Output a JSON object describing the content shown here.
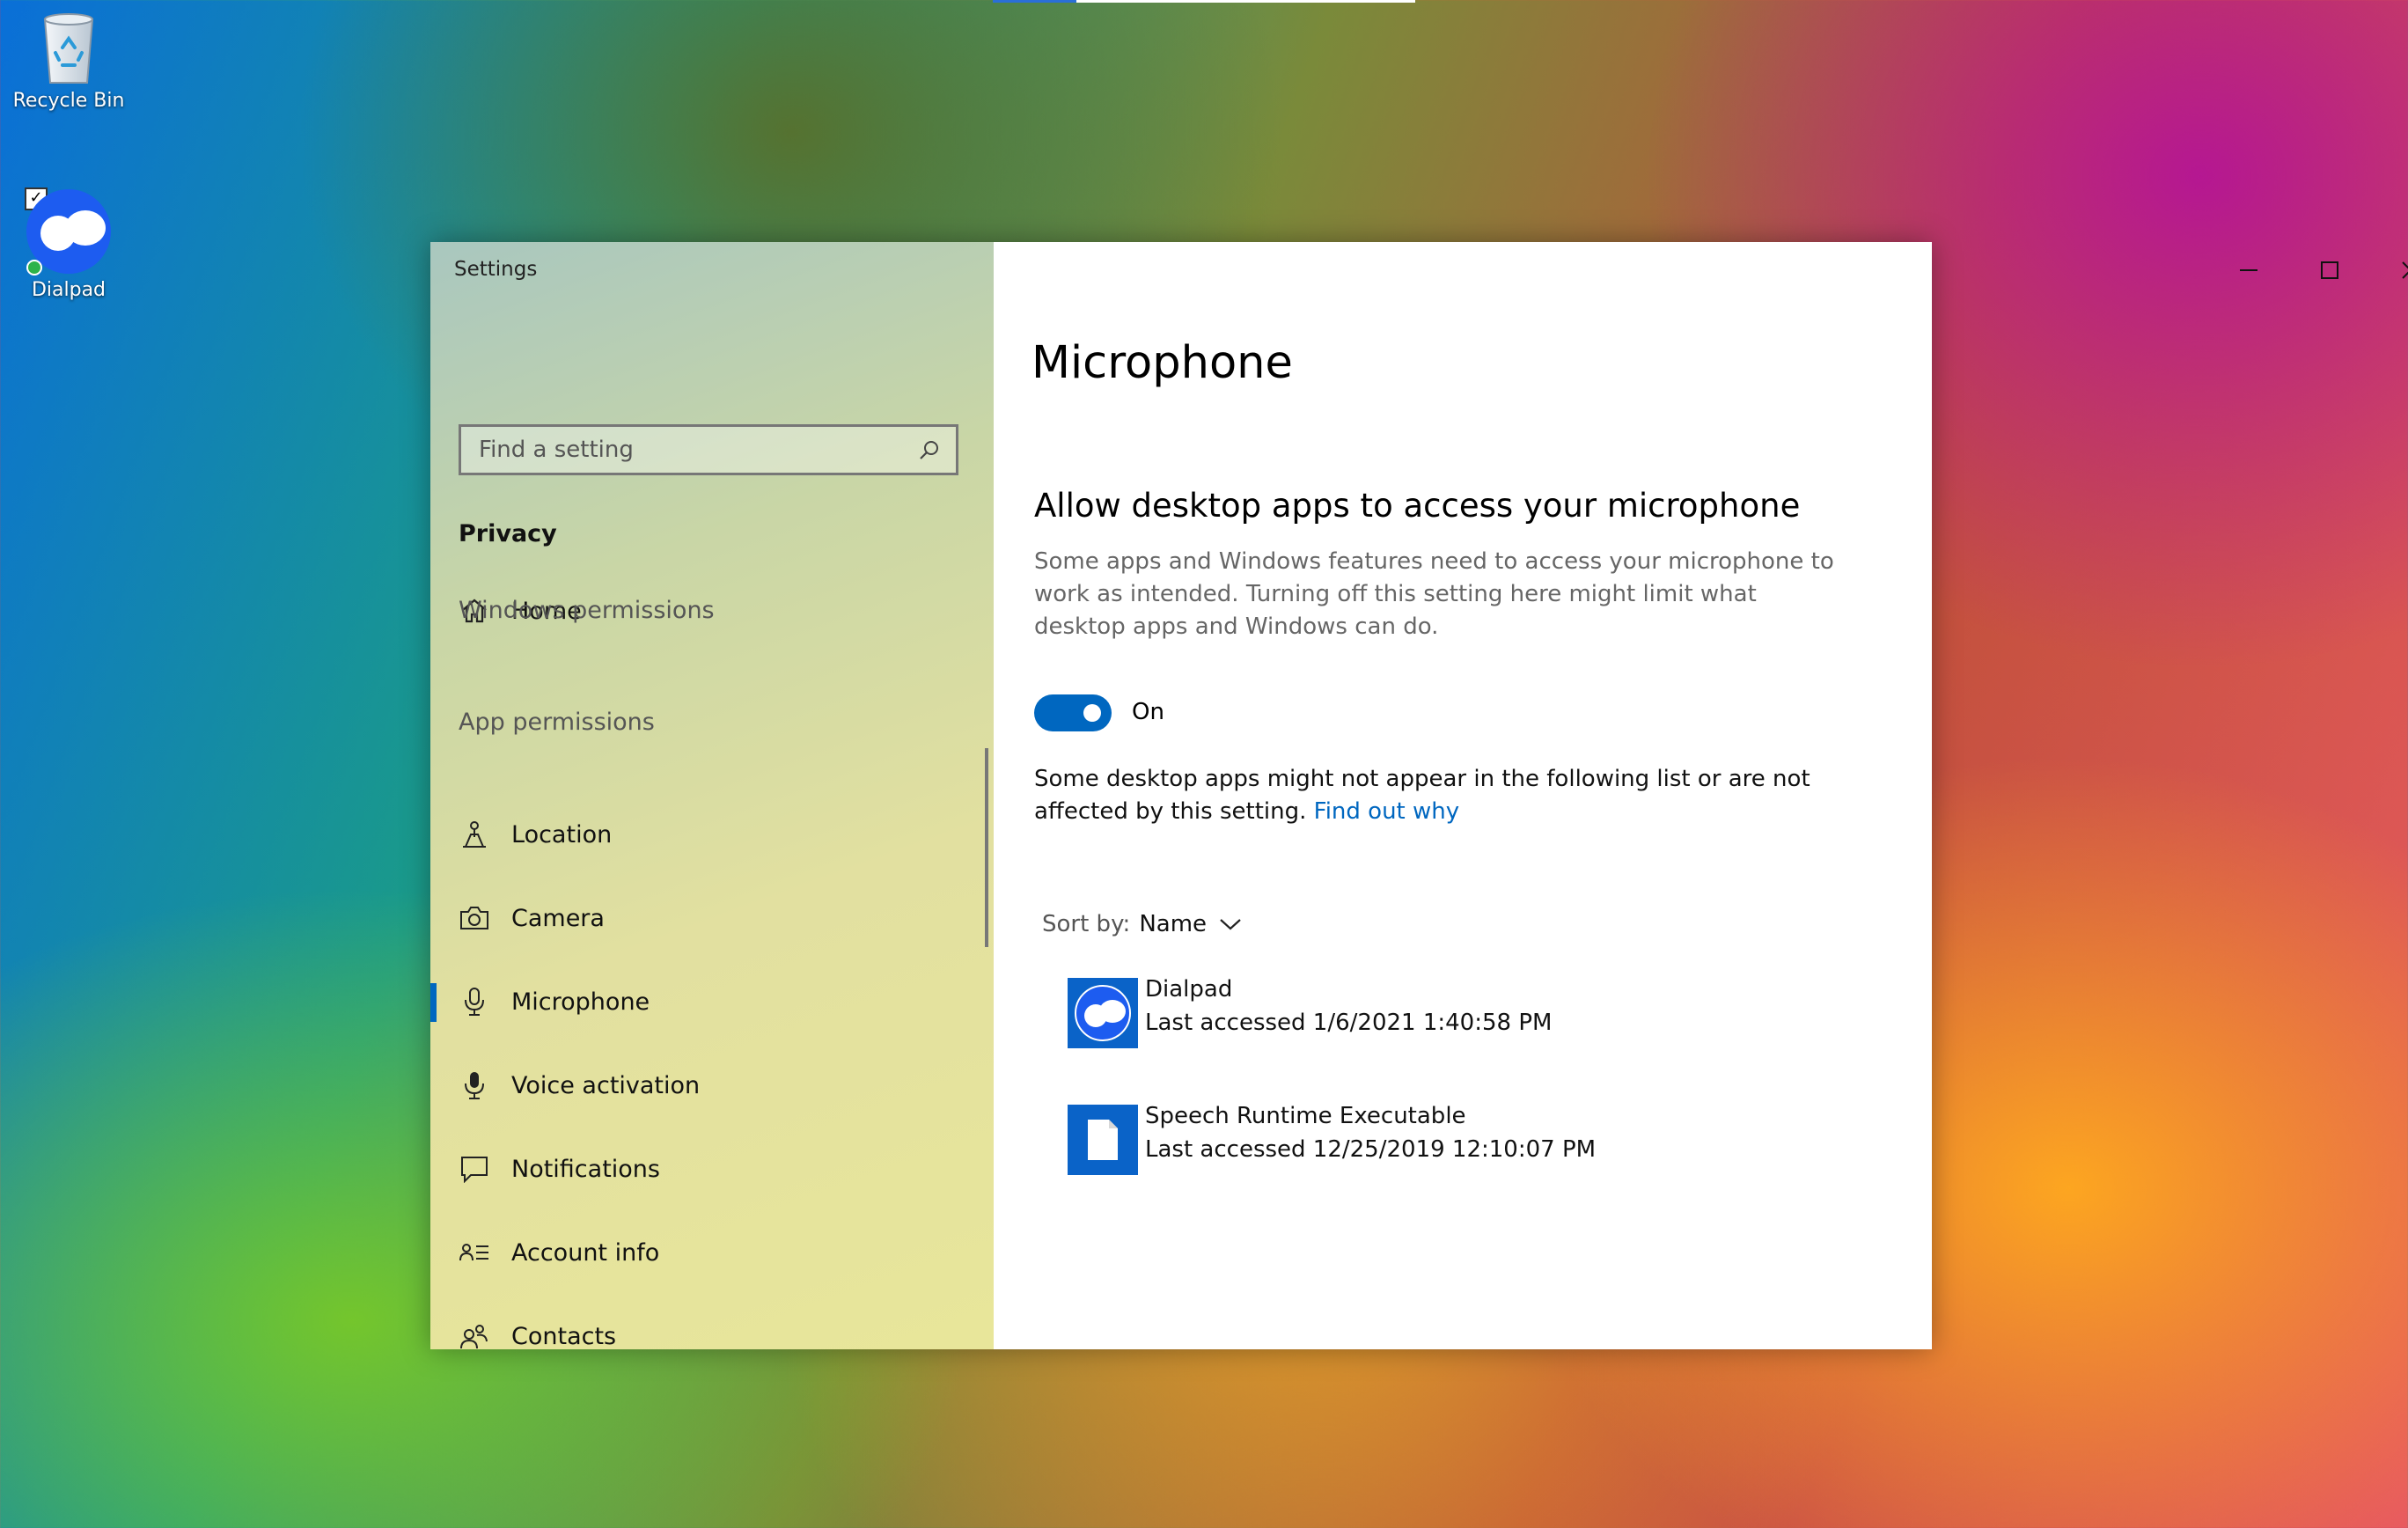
{
  "desktop": {
    "icons": [
      {
        "label": "Recycle Bin"
      },
      {
        "label": "Dialpad"
      }
    ]
  },
  "window": {
    "title": "Settings",
    "sidebar": {
      "home": "Home",
      "search_placeholder": "Find a setting",
      "section": "Privacy",
      "windows_permissions": "Windows permissions",
      "app_permissions": "App permissions",
      "items": [
        {
          "label": "Location",
          "icon": "location-icon"
        },
        {
          "label": "Camera",
          "icon": "camera-icon"
        },
        {
          "label": "Microphone",
          "icon": "microphone-icon",
          "active": true
        },
        {
          "label": "Voice activation",
          "icon": "voice-activation-icon"
        },
        {
          "label": "Notifications",
          "icon": "notifications-icon"
        },
        {
          "label": "Account info",
          "icon": "account-info-icon"
        },
        {
          "label": "Contacts",
          "icon": "contacts-icon"
        }
      ]
    },
    "content": {
      "title": "Microphone",
      "heading": "Allow desktop apps to access your microphone",
      "description": "Some apps and Windows features need to access your microphone to work as intended. Turning off this setting here might limit what desktop apps and Windows can do.",
      "toggle_state": "On",
      "note": "Some desktop apps might not appear in the following list or are not affected by this setting.",
      "find_out_link": "Find out why",
      "sort_label": "Sort by:",
      "sort_value": "Name",
      "apps": [
        {
          "name": "Dialpad",
          "last_accessed": "Last accessed 1/6/2021 1:40:58 PM"
        },
        {
          "name": "Speech Runtime Executable",
          "last_accessed": "Last accessed 12/25/2019 12:10:07 PM"
        }
      ]
    }
  },
  "colors": {
    "accent": "#0067c0",
    "app_tile": "#0a63c8",
    "dialpad_brand": "#1d5cf0"
  }
}
